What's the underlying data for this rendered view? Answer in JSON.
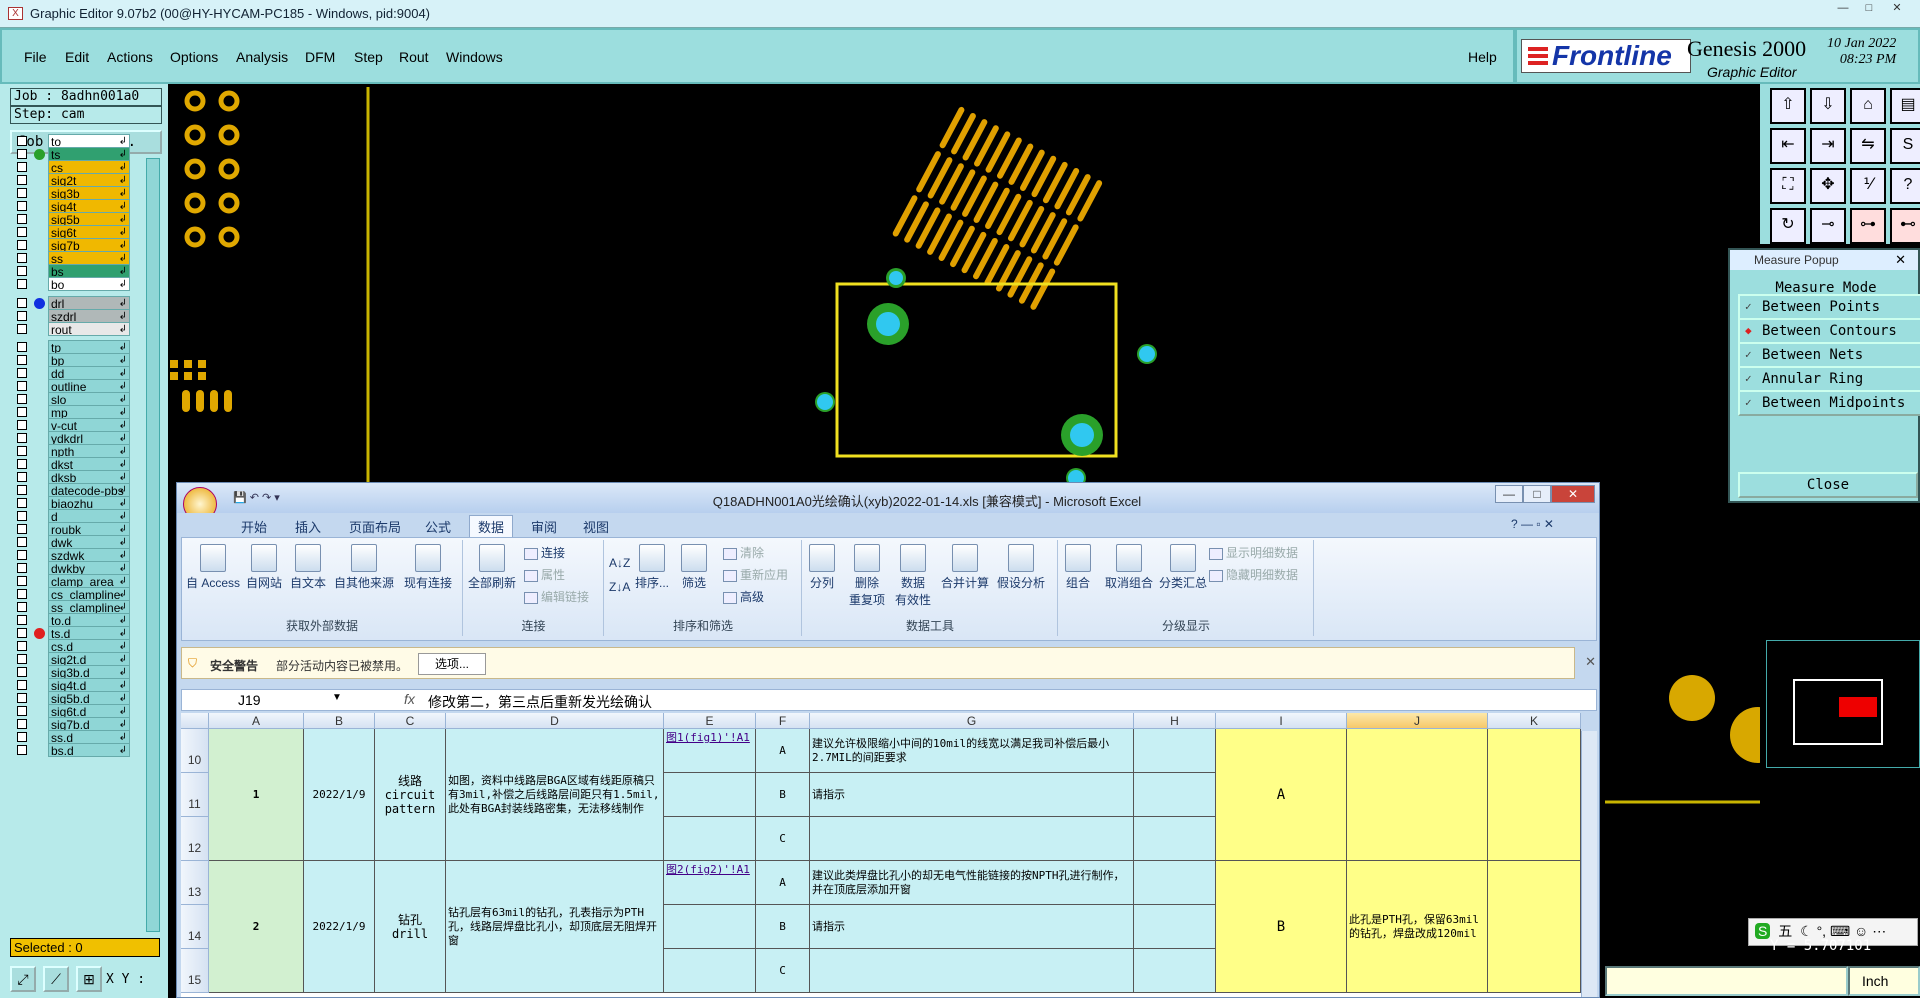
{
  "window": {
    "title": "Graphic Editor 9.07b2 (00@HY-HYCAM-PC185 - Windows, pid:9004)"
  },
  "menu": [
    "File",
    "Edit",
    "Actions",
    "Options",
    "Analysis",
    "DFM",
    "Step",
    "Rout",
    "Windows"
  ],
  "help": "Help",
  "brand": {
    "logo": "Frontline",
    "product": "Genesis 2000",
    "sub": "Graphic Editor",
    "date": "10 Jan 2022",
    "time": "08:23 PM"
  },
  "job": {
    "job_line": "Job : 8adhn001a0",
    "step_line": "Step: cam",
    "matrix_btn": "Job Matrix ..."
  },
  "layers_g1": [
    {
      "name": "to",
      "bg": "#ffffff",
      "dot": ""
    },
    {
      "name": "ts",
      "bg": "#30a070",
      "dot": "#2aa02a"
    },
    {
      "name": "cs",
      "bg": "#f0b800",
      "dot": ""
    },
    {
      "name": "sig2t",
      "bg": "#f0b800",
      "dot": ""
    },
    {
      "name": "sig3b",
      "bg": "#f0b800",
      "dot": ""
    },
    {
      "name": "sig4t",
      "bg": "#f0b800",
      "dot": ""
    },
    {
      "name": "sig5b",
      "bg": "#f0b800",
      "dot": ""
    },
    {
      "name": "sig6t",
      "bg": "#f0b800",
      "dot": ""
    },
    {
      "name": "sig7b",
      "bg": "#f0b800",
      "dot": ""
    },
    {
      "name": "ss",
      "bg": "#f0b800",
      "dot": ""
    },
    {
      "name": "bs",
      "bg": "#30a070",
      "dot": ""
    },
    {
      "name": "bo",
      "bg": "#ffffff",
      "dot": ""
    }
  ],
  "layers_g2": [
    {
      "name": "drl",
      "bg": "#b0b8b8",
      "dot": "#1030e0"
    },
    {
      "name": "szdrl",
      "bg": "#b0b8b8",
      "dot": ""
    },
    {
      "name": "rout",
      "bg": "#e8e8e8",
      "dot": ""
    }
  ],
  "layers_g3": [
    {
      "name": "tp",
      "bg": "#8fd6d6",
      "dot": ""
    },
    {
      "name": "bp",
      "bg": "#8fd6d6",
      "dot": ""
    },
    {
      "name": "dd",
      "bg": "#8fd6d6",
      "dot": ""
    },
    {
      "name": "outline",
      "bg": "#8fd6d6",
      "dot": ""
    },
    {
      "name": "slo",
      "bg": "#8fd6d6",
      "dot": ""
    },
    {
      "name": "mp",
      "bg": "#8fd6d6",
      "dot": ""
    },
    {
      "name": "v-cut",
      "bg": "#8fd6d6",
      "dot": ""
    },
    {
      "name": "ydkdrl",
      "bg": "#8fd6d6",
      "dot": ""
    },
    {
      "name": "npth",
      "bg": "#8fd6d6",
      "dot": ""
    },
    {
      "name": "dkst",
      "bg": "#8fd6d6",
      "dot": ""
    },
    {
      "name": "dksb",
      "bg": "#8fd6d6",
      "dot": ""
    },
    {
      "name": "datecode-pbs",
      "bg": "#8fd6d6",
      "dot": ""
    },
    {
      "name": "biaozhu",
      "bg": "#8fd6d6",
      "dot": ""
    },
    {
      "name": "d",
      "bg": "#8fd6d6",
      "dot": ""
    },
    {
      "name": "roubk",
      "bg": "#8fd6d6",
      "dot": ""
    },
    {
      "name": "dwk",
      "bg": "#8fd6d6",
      "dot": ""
    },
    {
      "name": "szdwk",
      "bg": "#8fd6d6",
      "dot": ""
    },
    {
      "name": "dwkby",
      "bg": "#8fd6d6",
      "dot": ""
    },
    {
      "name": "clamp_area",
      "bg": "#8fd6d6",
      "dot": ""
    },
    {
      "name": "cs_clampline",
      "bg": "#8fd6d6",
      "dot": ""
    },
    {
      "name": "ss_clampline",
      "bg": "#8fd6d6",
      "dot": ""
    },
    {
      "name": "to.d",
      "bg": "#8fd6d6",
      "dot": ""
    },
    {
      "name": "ts.d",
      "bg": "#8fd6d6",
      "dot": "#e02020"
    },
    {
      "name": "cs.d",
      "bg": "#8fd6d6",
      "dot": ""
    },
    {
      "name": "sig2t.d",
      "bg": "#8fd6d6",
      "dot": ""
    },
    {
      "name": "sig3b.d",
      "bg": "#8fd6d6",
      "dot": ""
    },
    {
      "name": "sig4t.d",
      "bg": "#8fd6d6",
      "dot": ""
    },
    {
      "name": "sig5b.d",
      "bg": "#8fd6d6",
      "dot": ""
    },
    {
      "name": "sig6t.d",
      "bg": "#8fd6d6",
      "dot": ""
    },
    {
      "name": "sig7b.d",
      "bg": "#8fd6d6",
      "dot": ""
    },
    {
      "name": "ss.d",
      "bg": "#8fd6d6",
      "dot": ""
    },
    {
      "name": "bs.d",
      "bg": "#8fd6d6",
      "dot": ""
    }
  ],
  "selected": "Selected : 0",
  "xy_label": "X Y :",
  "measure": {
    "title": "Measure Popup",
    "mode": "Measure Mode",
    "options": [
      "Between Points",
      "Between Contours",
      "Between Nets",
      "Annular Ring",
      "Between Midpoints"
    ],
    "selected_index": 1,
    "close": "Close"
  },
  "units": "Inch",
  "y_readout": "Y = 5.707101",
  "ime": "五",
  "excel": {
    "title": "Q18ADHN001A0光绘确认(xyb)2022-01-14.xls  [兼容模式]  -  Microsoft Excel",
    "tabs": [
      "开始",
      "插入",
      "页面布局",
      "公式",
      "数据",
      "审阅",
      "视图"
    ],
    "active_tab": 4,
    "groups": [
      {
        "label": "获取外部数据",
        "buttons": [
          "自 Access",
          "自网站",
          "自文本",
          "自其他来源",
          "现有连接"
        ]
      },
      {
        "label": "连接",
        "buttons": [
          "全部刷新"
        ],
        "small": [
          "连接",
          "属性",
          "编辑链接"
        ]
      },
      {
        "label": "排序和筛选",
        "buttons": [
          "排序...",
          "筛选"
        ],
        "small": [
          "清除",
          "重新应用",
          "高级"
        ]
      },
      {
        "label": "数据工具",
        "buttons": [
          "分列",
          "删除\n重复项",
          "数据\n有效性",
          "合并计算",
          "假设分析"
        ]
      },
      {
        "label": "分级显示",
        "buttons": [
          "组合",
          "取消组合",
          "分类汇总"
        ],
        "small": [
          "显示明细数据",
          "隐藏明细数据"
        ]
      }
    ],
    "security": {
      "label": "安全警告",
      "text": "部分活动内容已被禁用。",
      "button": "选项..."
    },
    "namebox": "J19",
    "formula": "修改第二，第三点后重新发光绘确认",
    "columns": [
      "A",
      "B",
      "C",
      "D",
      "E",
      "F",
      "G",
      "H",
      "I",
      "J",
      "K"
    ],
    "rows": [
      "10",
      "11",
      "12",
      "13",
      "14",
      "15"
    ],
    "data": [
      {
        "no": "1",
        "date": "2022/1/9",
        "type": "线路\ncircuit\npattern",
        "desc": "如图，资料中线路层BGA区域有线距原稿只有3mil,补偿之后线路层间距只有1.5mil,此处有BGA封装线路密集，无法移线制作",
        "link": "图1(fig1)'!A1",
        "opts": [
          "A",
          "B",
          "C"
        ],
        "sug": [
          "建议允许极限缩小中间的10mil的线宽以满足我司补偿后最小2.7MIL的间距要求",
          "请指示",
          ""
        ],
        "answer": "A",
        "remark": ""
      },
      {
        "no": "2",
        "date": "2022/1/9",
        "type": "钻孔\ndrill",
        "desc": "钻孔层有63mil的钻孔，孔表指示为PTH孔，线路层焊盘比孔小，却顶底层无阻焊开窗",
        "link": "图2(fig2)'!A1",
        "opts": [
          "A",
          "B",
          "C"
        ],
        "sug": [
          "建议此类焊盘比孔小的却无电气性能链接的按NPTH孔进行制作，并在顶底层添加开窗",
          "请指示",
          ""
        ],
        "answer": "B",
        "remark": "此孔是PTH孔，保留63mil的钻孔，焊盘改成120mil"
      }
    ]
  }
}
